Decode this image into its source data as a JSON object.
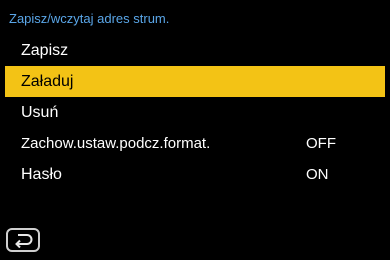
{
  "menu": {
    "title": "Zapisz/wczytaj adres strum.",
    "items": [
      {
        "label": "Zapisz",
        "value": ""
      },
      {
        "label": "Załaduj",
        "value": ""
      },
      {
        "label": "Usuń",
        "value": ""
      },
      {
        "label": "Zachow.ustaw.podcz.format.",
        "value": "OFF"
      },
      {
        "label": "Hasło",
        "value": "ON"
      }
    ],
    "selected_index": 1
  },
  "footer": {
    "back_icon": "return-arrow-icon"
  },
  "colors": {
    "title": "#5aa6e8",
    "highlight": "#f3c315",
    "background": "#000000",
    "text": "#ffffff"
  }
}
